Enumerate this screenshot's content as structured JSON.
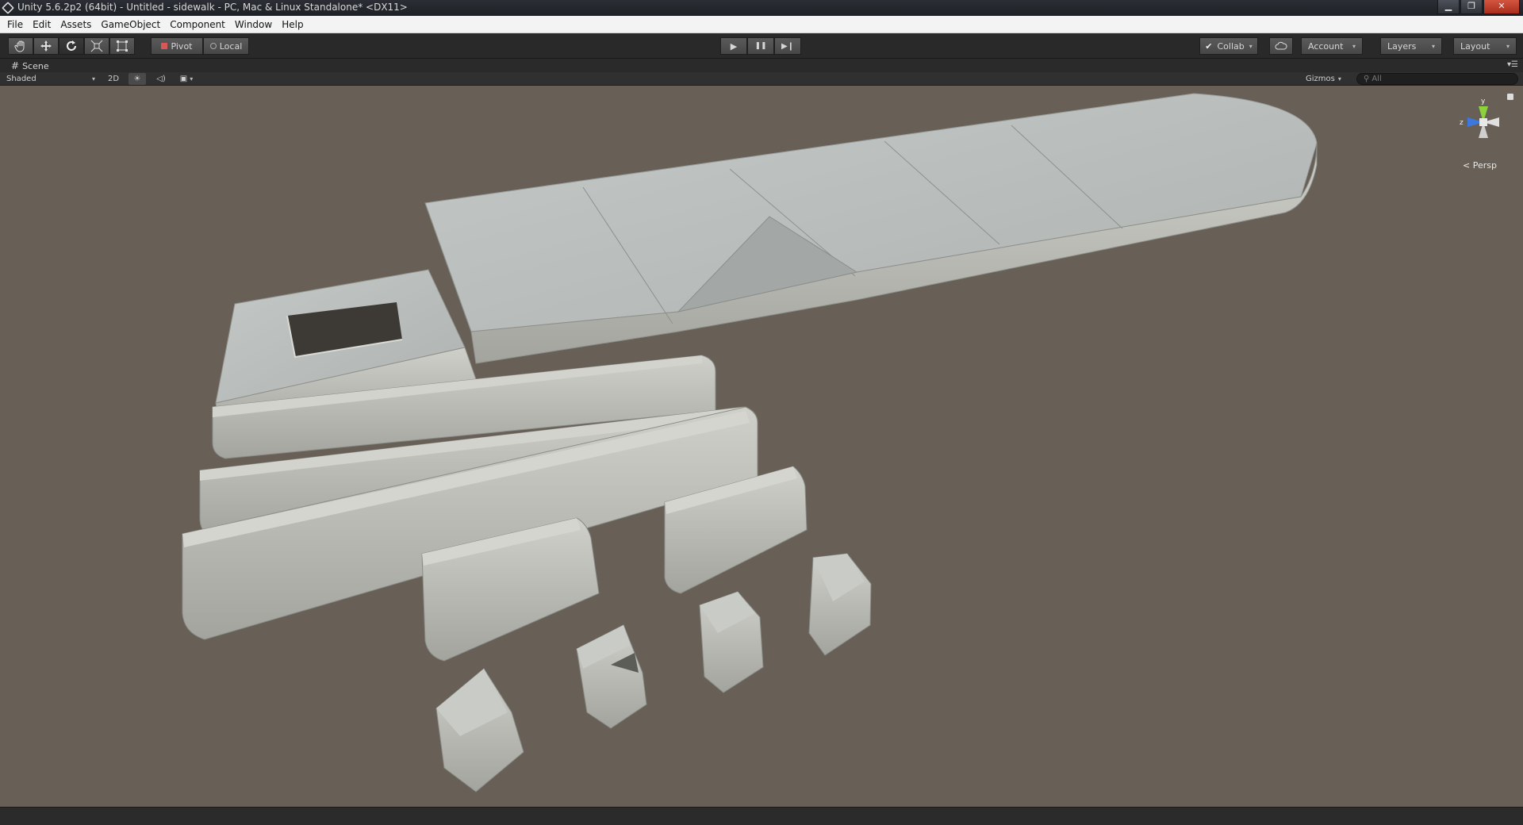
{
  "window": {
    "title": "Unity 5.6.2p2 (64bit) - Untitled - sidewalk - PC, Mac & Linux Standalone* <DX11>",
    "minimize": "▁",
    "restore": "❐",
    "close": "✕"
  },
  "menu": {
    "items": [
      "File",
      "Edit",
      "Assets",
      "GameObject",
      "Component",
      "Window",
      "Help"
    ]
  },
  "toolbar": {
    "tools": [
      "hand-tool",
      "move-tool",
      "rotate-tool",
      "scale-tool",
      "rect-tool"
    ],
    "active_tool": "rotate-tool",
    "pivot_label": "Pivot",
    "local_label": "Local",
    "play_icon": "▶",
    "pause_icon": "❚❚",
    "step_icon": "▶❙",
    "collab_label": "Collab",
    "account_label": "Account",
    "layers_label": "Layers",
    "layout_label": "Layout",
    "caret": "▾"
  },
  "scene": {
    "tab_label": "Scene",
    "shading_mode": "Shaded",
    "mode_2d": "2D",
    "gizmos_label": "Gizmos",
    "search_placeholder": "All",
    "projection_label": "Persp",
    "axis_y": "y",
    "axis_z": "z",
    "background_color": "#686056"
  },
  "colors": {
    "concrete_top": "#b9bdbb",
    "concrete_side": "#a9aba5",
    "concrete_dark": "#8a8c88",
    "hole": "#3d3a36",
    "gizmo_y": "#8cd23c",
    "gizmo_z": "#3c78e0",
    "gizmo_x": "#e0e0e0"
  }
}
